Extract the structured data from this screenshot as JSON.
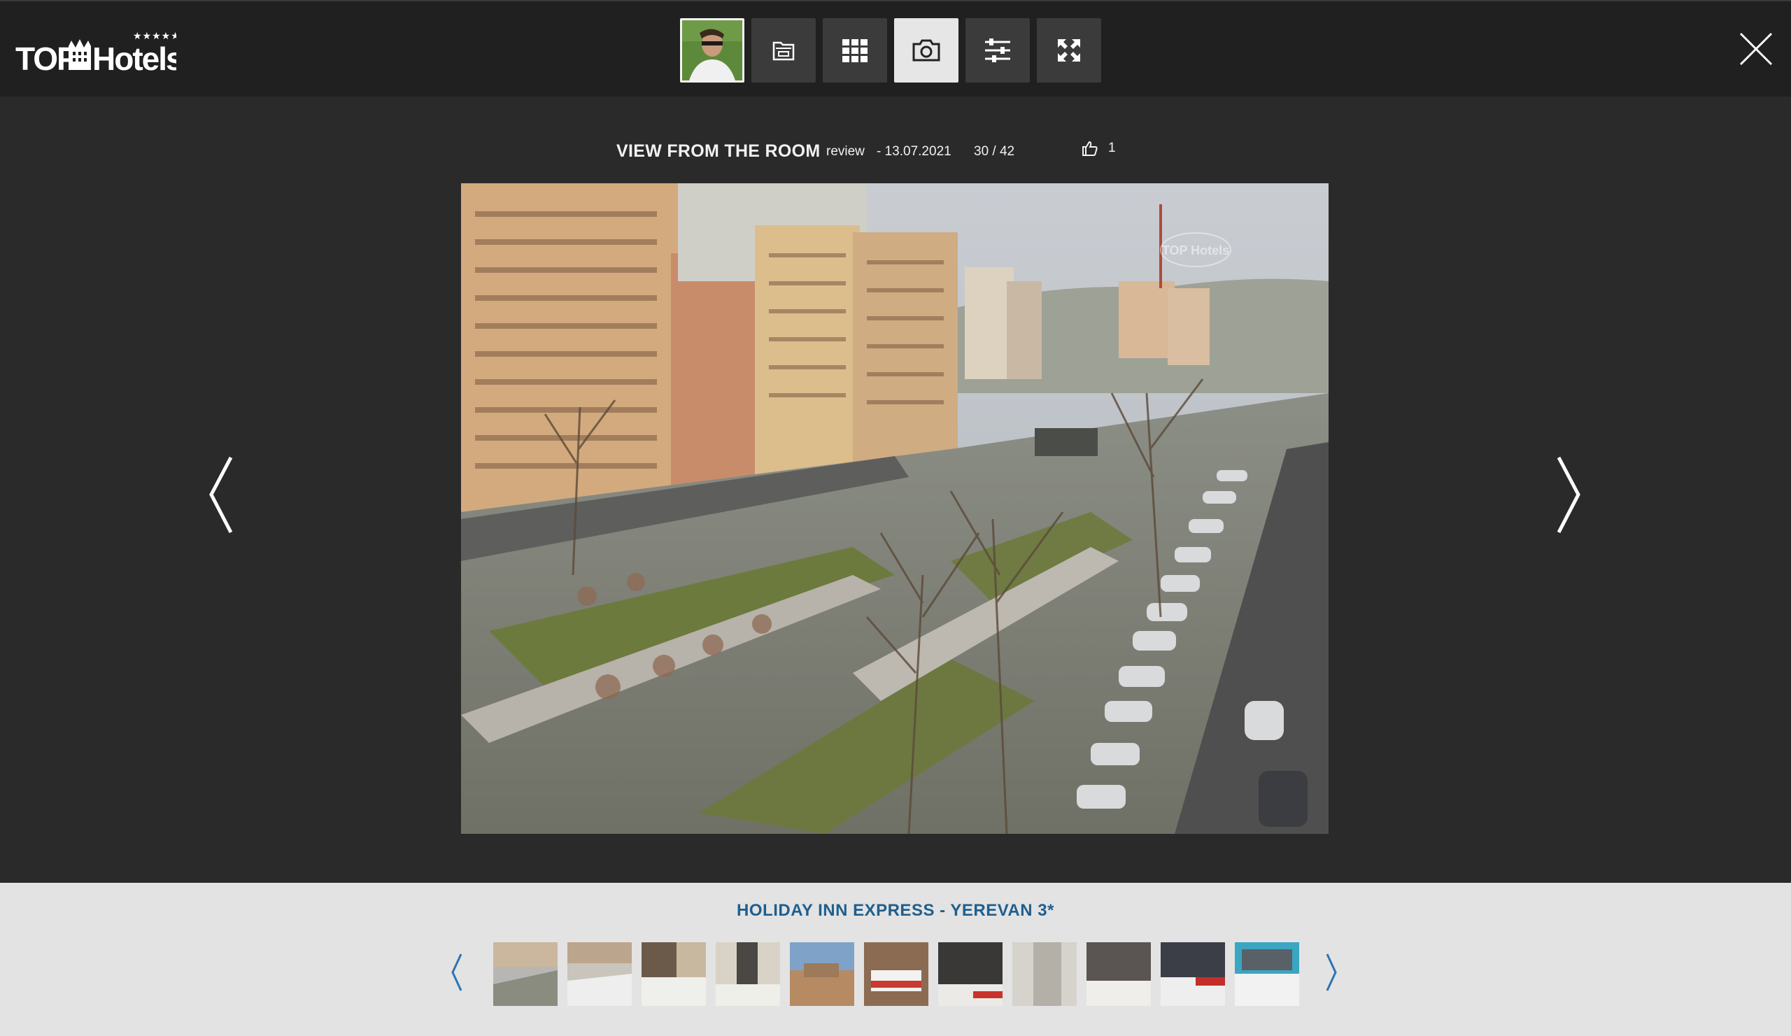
{
  "brand": {
    "logo_text": "TOP Hotels",
    "logo_stars": "★★★★★"
  },
  "toolbar": {
    "buttons": [
      {
        "name": "author-avatar",
        "icon": "user-photo",
        "active": false
      },
      {
        "name": "album",
        "icon": "folder-icon",
        "active": false
      },
      {
        "name": "grid",
        "icon": "grid-icon",
        "active": false
      },
      {
        "name": "photo",
        "icon": "camera-icon",
        "active": true
      },
      {
        "name": "filters",
        "icon": "sliders-icon",
        "active": false
      },
      {
        "name": "fullscreen",
        "icon": "expand-icon",
        "active": false
      }
    ],
    "close_icon": "close-icon"
  },
  "caption": {
    "title": "VIEW FROM THE ROOM",
    "source": "review",
    "date": "- 13.07.2021",
    "counter": "30 / 42",
    "likes": "1"
  },
  "photo": {
    "description_icon": "photo",
    "watermark": "TOP Hotels"
  },
  "strip": {
    "hotel_name": "HOLIDAY INN EXPRESS - YEREVAN 3*",
    "thumbnails": [
      {
        "label": "thumb-1"
      },
      {
        "label": "thumb-2"
      },
      {
        "label": "thumb-3"
      },
      {
        "label": "thumb-4"
      },
      {
        "label": "thumb-5"
      },
      {
        "label": "thumb-6"
      },
      {
        "label": "thumb-7"
      },
      {
        "label": "thumb-8"
      },
      {
        "label": "thumb-9"
      },
      {
        "label": "thumb-10"
      },
      {
        "label": "thumb-11"
      }
    ]
  },
  "colors": {
    "accent": "#1f5f8e",
    "background": "#2a2a2a",
    "header": "#202020",
    "strip": "#e3e3e3"
  }
}
